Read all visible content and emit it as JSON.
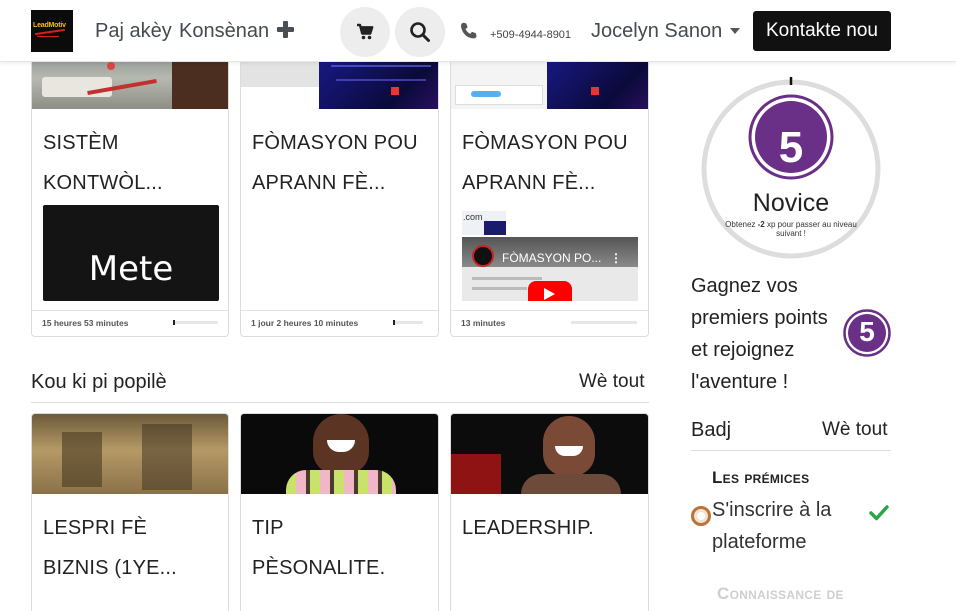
{
  "header": {
    "logo_text": "LeadMotiv",
    "nav": [
      "Paj akèy",
      "Konsènan"
    ],
    "phone": "+509-4944-8901",
    "user": "Jocelyn Sanon",
    "contact_label": "Kontakte nou",
    "icons": [
      "plus-icon",
      "cart-icon",
      "search-icon",
      "phone-icon",
      "caret-down-icon"
    ]
  },
  "courses_top": [
    {
      "title_line1": "SISTÈM",
      "title_line2": "KONTWÒL...",
      "overlay_text": "Mete",
      "duration": "15 heures 53 minutes",
      "progress": 0.02
    },
    {
      "title_line1": "FÒMASYON POU",
      "title_line2": "APRANN FÈ...",
      "duration": "1 jour 2 heures 10 minutes",
      "progress": 0.02
    },
    {
      "title_line1": "FÒMASYON POU",
      "title_line2": "APRANN FÈ...",
      "video_title": "FÒMASYON PO...",
      "thumb_text": ".com",
      "duration": "13 minutes",
      "progress": 0
    }
  ],
  "popular": {
    "title": "Kou ki pi popilè",
    "see_all": "Wè tout",
    "courses": [
      {
        "title_line1": "LESPRI FÈ",
        "title_line2": "BIZNIS (1YE..."
      },
      {
        "title_line1": "TIP",
        "title_line2": "PÈSONALITE."
      },
      {
        "title_line1": "LEADERSHIP.",
        "title_line2": ""
      }
    ]
  },
  "sidebar": {
    "level": "5",
    "level_name": "Novice",
    "xp_note_prefix": "Obtenez ",
    "xp_value": "-2",
    "xp_note_suffix": " xp pour passer au niveau suivant !",
    "progress": 0.0,
    "promo": "Gagnez vos premiers points et rejoignez l'aventure !",
    "promo_badge": "5",
    "badges_title": "Badj",
    "badges_see_all": "Wè tout",
    "category": "Les prémices",
    "badge_item": "S'inscrire à la plateforme",
    "badge_done": true,
    "next_category": "Connaissance de"
  },
  "colors": {
    "accent": "#6a2f86",
    "dark_button": "#111111",
    "check": "#28a745",
    "ring": "#dddddd",
    "badge_bronze": "#b9733b"
  }
}
